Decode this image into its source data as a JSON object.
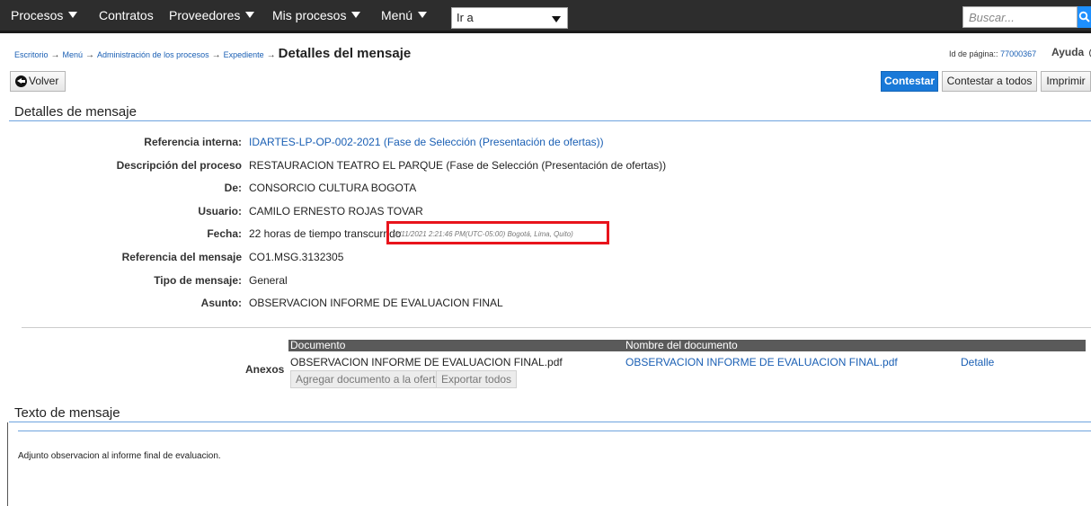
{
  "topnav": {
    "items": [
      "Procesos",
      "Contratos",
      "Proveedores",
      "Mis procesos",
      "Menú"
    ],
    "goto_value": "Ir a",
    "search_placeholder": "Buscar..."
  },
  "breadcrumb": {
    "links": [
      "Escritorio",
      "Menú",
      "Administración de los procesos",
      "Expediente"
    ],
    "current": "Detalles del mensaje",
    "arrow": "→"
  },
  "page_id": {
    "label": "Id de página::",
    "value": "77000367"
  },
  "help_label": "Ayuda",
  "help_icon_glyph": "?",
  "buttons": {
    "back": "Volver",
    "reply": "Contestar",
    "reply_all": "Contestar a todos",
    "print": "Imprimir"
  },
  "details_section": {
    "title": "Detalles de mensaje",
    "fields": [
      {
        "label": "Referencia interna:",
        "value": "IDARTES-LP-OP-002-2021 (Fase de Selección (Presentación de ofertas))"
      },
      {
        "label": "Descripción del proceso",
        "value": "RESTAURACION TEATRO EL PARQUE (Fase de Selección (Presentación de ofertas))"
      },
      {
        "label": "De:",
        "value": "CONSORCIO CULTURA BOGOTA"
      },
      {
        "label": "Usuario:",
        "value": "CAMILO ERNESTO ROJAS TOVAR"
      },
      {
        "label": "Fecha:",
        "value": "22 horas de tiempo transcurrido"
      },
      {
        "label": "Referencia del mensaje",
        "value": "CO1.MSG.3132305"
      },
      {
        "label": "Tipo de mensaje:",
        "value": "General"
      },
      {
        "label": "Asunto:",
        "value": "OBSERVACION INFORME DE EVALUACION FINAL"
      }
    ],
    "timestamp": "(2/11/2021 2:21:46 PM(UTC-05:00) Bogotá, Lima, Quito)"
  },
  "attachments": {
    "label": "Anexos",
    "columns": [
      "Documento",
      "Nombre del documento"
    ],
    "rows": [
      {
        "document": "OBSERVACION INFORME DE EVALUACION FINAL.pdf",
        "name": "OBSERVACION INFORME DE EVALUACION FINAL.pdf",
        "action": "Detalle"
      }
    ],
    "add_button": "Agregar documento a la oferta",
    "export_button": "Exportar todos"
  },
  "message_section": {
    "title": "Texto de mensaje",
    "body": "Adjunto observacion al informe final de evaluacion."
  },
  "colors": {
    "topbar": "#2d2d2d",
    "primary": "#1979d8",
    "link": "#1a5fb4",
    "highlight": "#e8141c"
  }
}
